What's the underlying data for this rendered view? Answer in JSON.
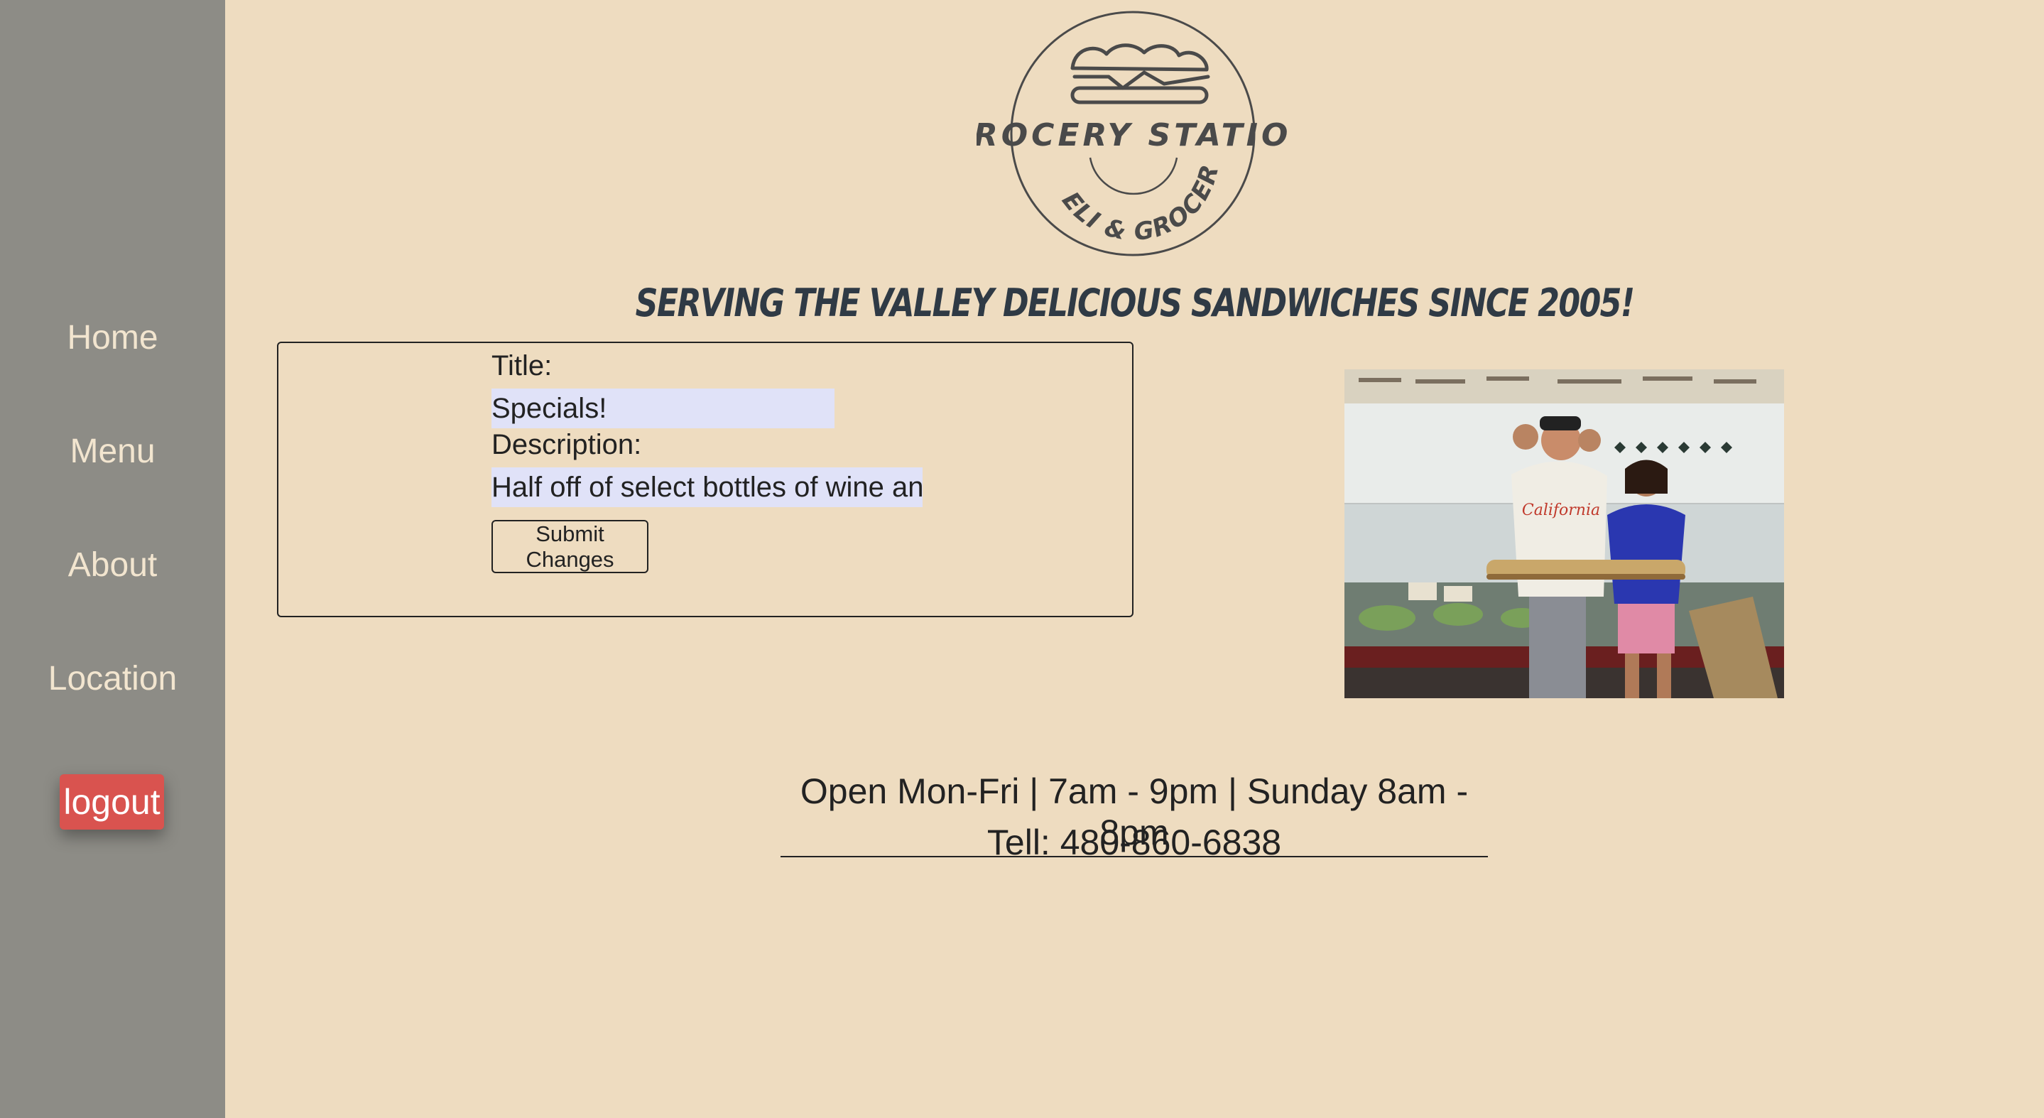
{
  "nav": {
    "home": "Home",
    "menu": "Menu",
    "about": "About",
    "location": "Location",
    "logout": "logout"
  },
  "logo": {
    "name": "GROCERY STATION",
    "subtitle": "DELI & GROCERY",
    "icon": "sandwich-icon"
  },
  "slogan": "SERVING THE VALLEY DELICIOUS SANDWICHES SINCE 2005!",
  "form": {
    "title_label": "Title:",
    "title_value": "Specials!",
    "description_label": "Description:",
    "description_value": "Half off of select bottles of wine and",
    "submit_label": "Submit Changes"
  },
  "info": {
    "hours": "Open Mon-Fri | 7am - 9pm | Sunday 8am - 8pm",
    "phone": "Tell: 480-860-6838"
  },
  "colors": {
    "background": "#eedcc0",
    "sidebar": "#8d8c86",
    "logout": "#d9534f",
    "input_fill": "#e0e2f8"
  }
}
